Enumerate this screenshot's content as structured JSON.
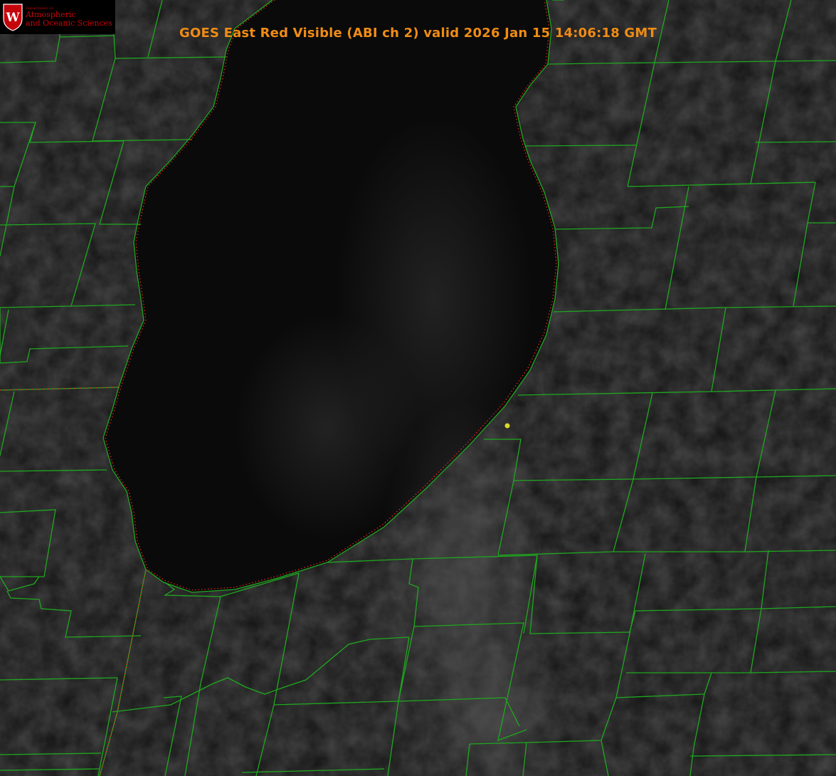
{
  "map": {
    "title": "GOES East Red Visible (ABI ch 2) valid 2026 Jan 15 14:06:18 GMT",
    "satellite": "GOES East",
    "channel": "Red Visible (ABI ch 2)",
    "valid_time": "2026 Jan 15 14:06:18 GMT",
    "colors": {
      "background": "#050505",
      "lake": "#0b0b0b",
      "county_lines": "#1fa81f",
      "shoreline_dotted": "#ff2020",
      "marker": "#d9d92a",
      "title": "#f08c14",
      "logo_text": "#c5050c"
    },
    "marker_name": "location-marker"
  },
  "logo": {
    "crest_letter": "W",
    "department_line": "Department of",
    "name_line1": "Atmospheric",
    "name_line2": "and Oceanic Sciences"
  }
}
